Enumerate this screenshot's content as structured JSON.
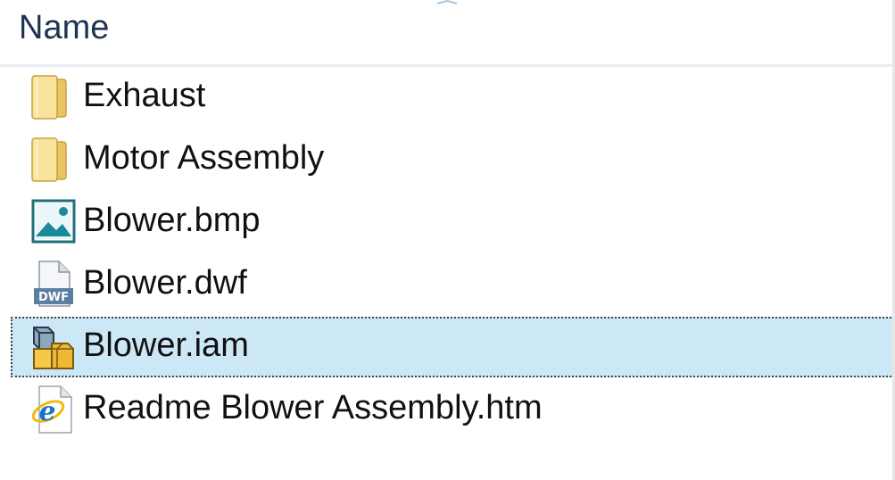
{
  "header": {
    "name_label": "Name"
  },
  "files": [
    {
      "name": "Exhaust",
      "icon": "folder-icon"
    },
    {
      "name": "Motor Assembly",
      "icon": "folder-icon"
    },
    {
      "name": "Blower.bmp",
      "icon": "bitmap-image-icon"
    },
    {
      "name": "Blower.dwf",
      "icon": "dwf-file-icon",
      "badge": "DWF"
    },
    {
      "name": "Blower.iam",
      "icon": "inventor-assembly-icon",
      "selected": true
    },
    {
      "name": "Readme Blower Assembly.htm",
      "icon": "internet-explorer-html-icon"
    }
  ],
  "colors": {
    "selection_bg": "#cce8f6",
    "header_text": "#1e3350",
    "folder": "#f1d27a"
  }
}
